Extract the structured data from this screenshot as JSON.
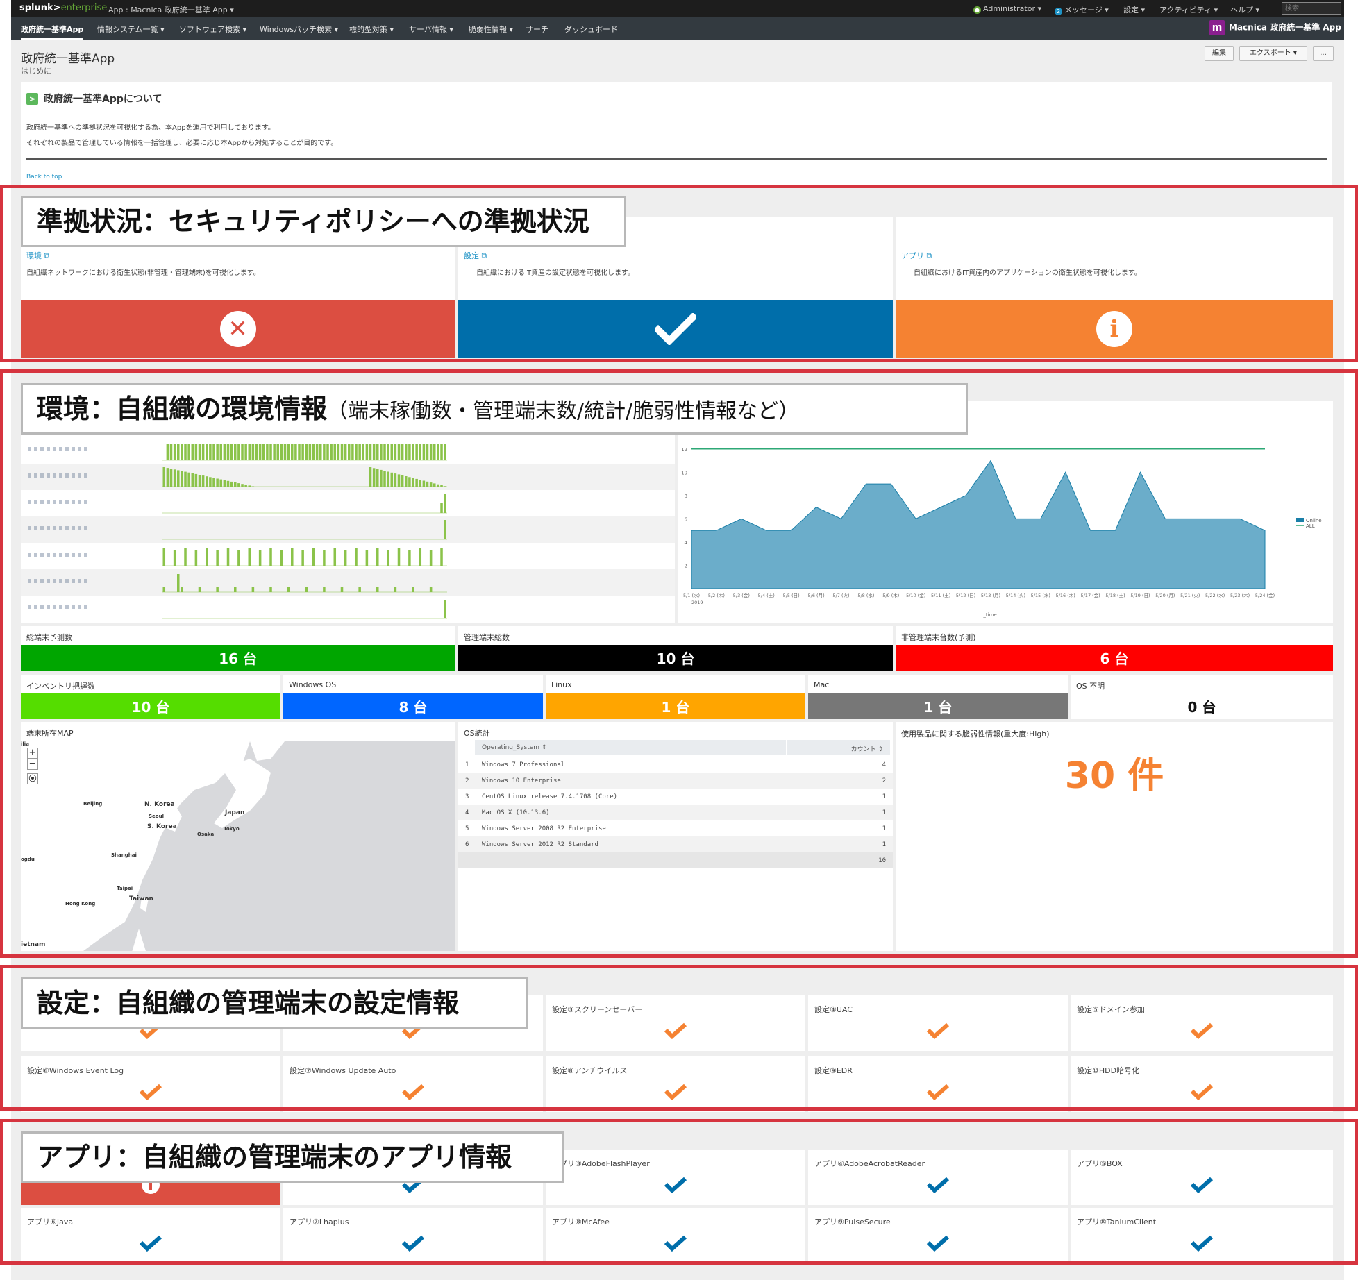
{
  "topbar": {
    "logo_main": "splunk>",
    "logo_ent": "enterprise",
    "app_menu": "App : Macnica 政府統一基準 App ▾",
    "user": "Administrator ▾",
    "messages_count": "2",
    "messages": "メッセージ ▾",
    "settings": "設定 ▾",
    "activity": "アクティビティ ▾",
    "help": "ヘルプ ▾",
    "search_placeholder": "検索"
  },
  "nav": {
    "items": [
      "政府統一基準App",
      "情報システム一覧 ▾",
      "ソフトウェア検索 ▾",
      "Windowsパッチ検索 ▾",
      "標的型対策 ▾",
      "サーバ情報 ▾",
      "脆弱性情報 ▾",
      "サーチ",
      "ダッシュボード"
    ],
    "brand": "Macnica 政府統一基準 App"
  },
  "header": {
    "title": "政府統一基準App",
    "subtitle": "はじめに",
    "edit": "編集",
    "export": "エクスポート ▾",
    "more": "..."
  },
  "intro": {
    "title": "政府統一基準Appについて",
    "line1": "政府統一基準への準拠状況を可視化する為、本Appを運用で利用しております。",
    "line2": "それぞれの製品で管理している情報を一括管理し、必要に応じ本Appから対処することが目的です。",
    "back_to_top": "Back to top"
  },
  "callouts": {
    "compliance": "準拠状況：セキュリティポリシーへの準拠状況",
    "env_main": "環境：自組織の環境情報",
    "env_sub": "（端末稼働数・管理端末数/統計/脆弱性情報など）",
    "settings": "設定：自組織の管理端末の設定情報",
    "apps": "アプリ：自組織の管理端末のアプリ情報"
  },
  "compliance": {
    "sections": [
      {
        "link": "環境 ⧉",
        "desc": "自組織ネットワークにおける衛生状態(非管理・管理端末)を可視化します。",
        "color": "#dc4e41",
        "icon": "✕",
        "status": "error"
      },
      {
        "link": "設定 ⧉",
        "desc": "自組織におけるIT資産の設定状態を可視化します。",
        "color": "#006eaa",
        "icon": "✔",
        "status": "ok"
      },
      {
        "link": "アプリ ⧉",
        "desc": "自組織におけるIT資産内のアプリケーションの衛生状態を可視化します。",
        "color": "#f58232",
        "icon": "i",
        "status": "info"
      }
    ]
  },
  "env": {
    "sparklines": [
      {
        "pattern": "full"
      },
      {
        "pattern": "two-decay"
      },
      {
        "pattern": "end-spike"
      },
      {
        "pattern": "end-bar"
      },
      {
        "pattern": "weekly"
      },
      {
        "pattern": "sparse"
      },
      {
        "pattern": "end-small"
      }
    ],
    "area_chart": {
      "y_ticks": [
        "12",
        "10",
        "8",
        "6",
        "4",
        "2"
      ],
      "x_labels": [
        "5/1 (水)",
        "5/2 (木)",
        "5/3 (金)",
        "5/4 (土)",
        "5/5 (日)",
        "5/6 (月)",
        "5/7 (火)",
        "5/8 (水)",
        "5/9 (木)",
        "5/10 (金)",
        "5/11 (土)",
        "5/12 (日)",
        "5/13 (月)",
        "5/14 (火)",
        "5/15 (水)",
        "5/16 (木)",
        "5/17 (金)",
        "5/18 (土)",
        "5/19 (日)",
        "5/20 (月)",
        "5/21 (火)",
        "5/22 (水)",
        "5/23 (木)",
        "5/24 (金)"
      ],
      "year": "2019",
      "xlabel": "_time",
      "online": [
        5,
        5,
        6,
        5,
        5,
        7,
        6,
        9,
        9,
        6,
        7,
        8,
        11,
        6,
        6,
        10,
        5,
        5,
        10,
        6,
        6,
        6,
        6,
        5
      ],
      "all_value": 12,
      "ylim": [
        0,
        13
      ],
      "legend": [
        "Online",
        "ALL"
      ],
      "colors": {
        "online": "#1a7fa8",
        "all": "#2ea876"
      }
    },
    "kpis_row1": [
      {
        "label": "総端末予測数",
        "value": "16 台",
        "color": "#00a600"
      },
      {
        "label": "管理端末総数",
        "value": "10 台",
        "color": "#000000"
      },
      {
        "label": "非管理端末台数(予測)",
        "value": "6 台",
        "color": "#ff0000"
      }
    ],
    "kpis_row2": [
      {
        "label": "インベントリ把握数",
        "value": "10 台",
        "color": "#55dd00"
      },
      {
        "label": "Windows OS",
        "value": "8 台",
        "color": "#0066ff"
      },
      {
        "label": "Linux",
        "value": "1 台",
        "color": "#ffa500"
      },
      {
        "label": "Mac",
        "value": "1 台",
        "color": "#777777"
      },
      {
        "label": "OS 不明",
        "value": "0 台",
        "color": "#ffffff"
      }
    ],
    "map": {
      "label": "端末所在MAP",
      "zoom_in": "+",
      "zoom_out": "−",
      "locate": "⦿",
      "cities": [
        "N. Korea",
        "Japan",
        "S. Korea",
        "Beijing",
        "Seoul",
        "Tokyo",
        "Osaka",
        "Shanghai",
        "Taipei",
        "Taiwan",
        "Hong Kong",
        "ietnam",
        "ogdu",
        "ilia"
      ]
    },
    "os_table": {
      "label": "OS統計",
      "headers": [
        "Operating_System ⇕",
        "カウント ⇕"
      ],
      "rows": [
        {
          "n": "1",
          "os": "Windows 7 Professional",
          "count": "4"
        },
        {
          "n": "2",
          "os": "Windows 10 Enterprise",
          "count": "2"
        },
        {
          "n": "3",
          "os": "CentOS Linux release 7.4.1708 (Core)",
          "count": "1"
        },
        {
          "n": "4",
          "os": "Mac OS X (10.13.6)",
          "count": "1"
        },
        {
          "n": "5",
          "os": "Windows Server 2008 R2 Enterprise",
          "count": "1"
        },
        {
          "n": "6",
          "os": "Windows Server 2012 R2 Standard",
          "count": "1"
        }
      ],
      "total": "10"
    },
    "vuln": {
      "label": "使用製品に関する脆弱性情報(重大度:High)",
      "value": "30 件"
    }
  },
  "settings_grid": {
    "row1": [
      {
        "label": "",
        "status": "warn"
      },
      {
        "label": "",
        "status": "warn"
      },
      {
        "label": "設定③スクリーンセーバー",
        "status": "warn"
      },
      {
        "label": "設定④UAC",
        "status": "warn"
      },
      {
        "label": "設定⑤ドメイン参加",
        "status": "warn"
      }
    ],
    "row2": [
      {
        "label": "設定⑥Windows Event Log",
        "status": "warn"
      },
      {
        "label": "設定⑦Windows Update Auto",
        "status": "warn"
      },
      {
        "label": "設定⑧アンチウイルス",
        "status": "warn"
      },
      {
        "label": "設定⑨EDR",
        "status": "warn"
      },
      {
        "label": "設定⑩HDD暗号化",
        "status": "warn"
      }
    ]
  },
  "apps_grid": {
    "row1": [
      {
        "label": "",
        "status": "error"
      },
      {
        "label": "",
        "status": "ok"
      },
      {
        "label": "アプリ③AdobeFlashPlayer",
        "status": "ok"
      },
      {
        "label": "アプリ④AdobeAcrobatReader",
        "status": "ok"
      },
      {
        "label": "アプリ⑤BOX",
        "status": "ok"
      }
    ],
    "row2": [
      {
        "label": "アプリ⑥Java",
        "status": "ok"
      },
      {
        "label": "アプリ⑦Lhaplus",
        "status": "ok"
      },
      {
        "label": "アプリ⑧McAfee",
        "status": "ok"
      },
      {
        "label": "アプリ⑨PulseSecure",
        "status": "ok"
      },
      {
        "label": "アプリ⑩TaniumClient",
        "status": "ok"
      }
    ]
  },
  "colors": {
    "warn_check": "#f58232",
    "ok_check": "#006eaa",
    "callout_border": "#d6343f"
  }
}
